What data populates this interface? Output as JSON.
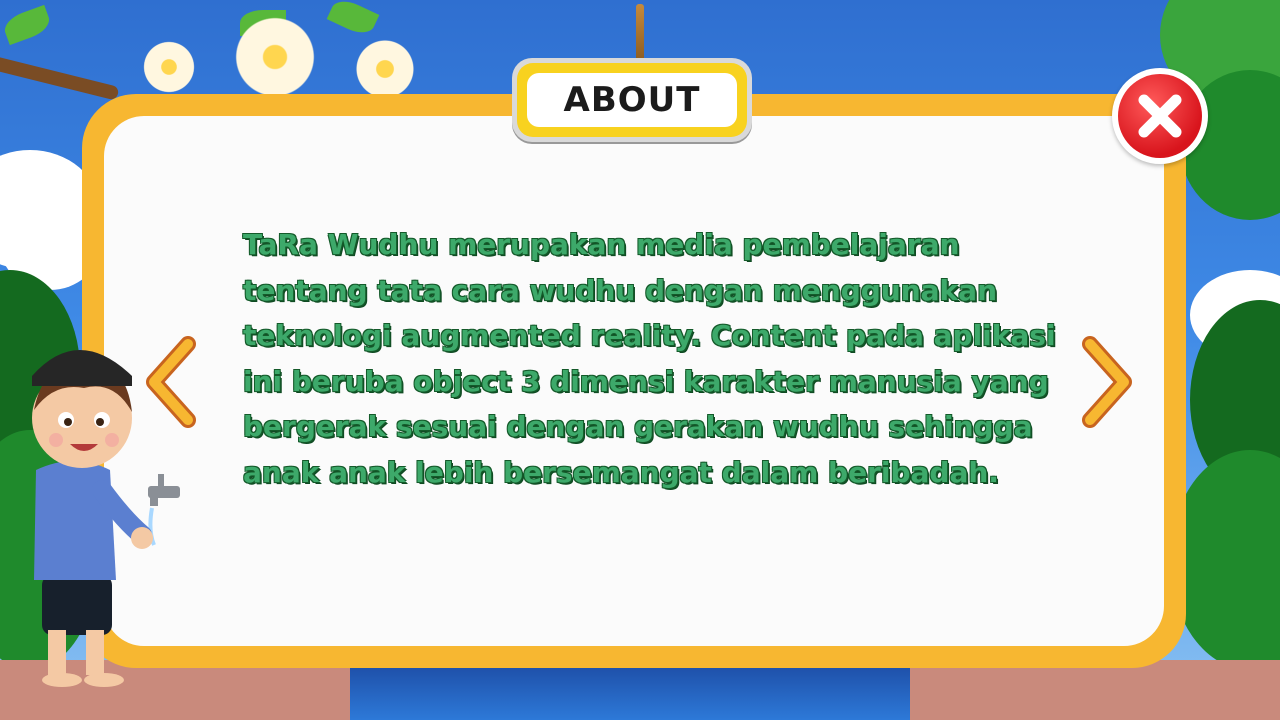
{
  "dialog": {
    "title": "ABOUT",
    "text": "TaRa Wudhu merupakan media pembelajaran tentang tata cara wudhu dengan menggunakan teknologi augmented reality. Content pada aplikasi ini beruba object 3 dimensi karakter manusia yang bergerak sesuai dengan gerakan wudhu sehingga anak anak lebih bersemangat dalam beribadah."
  },
  "icons": {
    "close": "close-x-icon",
    "prev": "chevron-left-icon",
    "next": "chevron-right-icon"
  },
  "colors": {
    "panel_border": "#f7b731",
    "panel_fill": "#fbfbfb",
    "text_fill": "#3da96a",
    "text_outline": "#145a2a",
    "close_button": "#d8141c",
    "arrow": "#f7b731"
  }
}
